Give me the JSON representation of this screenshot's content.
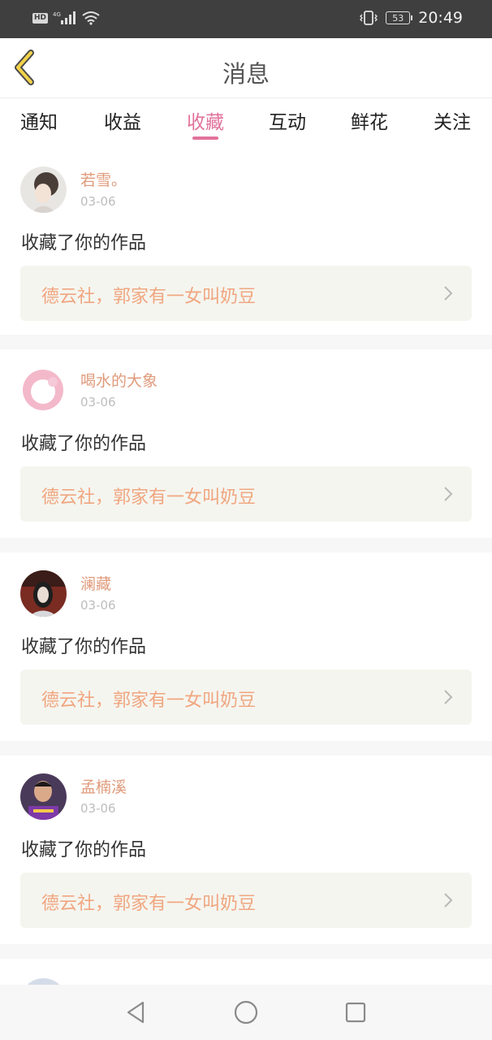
{
  "status_bar": {
    "network_badge": "HD",
    "network_type": "4G",
    "battery": "53",
    "time": "20:49"
  },
  "header": {
    "title": "消息"
  },
  "tabs": [
    {
      "label": "通知"
    },
    {
      "label": "收益"
    },
    {
      "label": "收藏"
    },
    {
      "label": "互动"
    },
    {
      "label": "鲜花"
    },
    {
      "label": "关注"
    }
  ],
  "active_tab": "收藏",
  "messages": [
    {
      "user": "若雪。",
      "date": "03-06",
      "action": "收藏了你的作品",
      "work": "德云社，郭家有一女叫奶豆"
    },
    {
      "user": "喝水的大象",
      "date": "03-06",
      "action": "收藏了你的作品",
      "work": "德云社，郭家有一女叫奶豆"
    },
    {
      "user": "澜藏",
      "date": "03-06",
      "action": "收藏了你的作品",
      "work": "德云社，郭家有一女叫奶豆"
    },
    {
      "user": "孟楠溪",
      "date": "03-06",
      "action": "收藏了你的作品",
      "work": "德云社，郭家有一女叫奶豆"
    }
  ],
  "colors": {
    "accent": "#e2729b",
    "username": "#e09b7c",
    "work_title": "#f0a680",
    "back_arrow": "#f2d24a"
  },
  "icons": {
    "back": "chevron-left-icon",
    "nav_back": "triangle-back-icon",
    "nav_home": "circle-home-icon",
    "nav_recent": "square-recent-icon"
  }
}
